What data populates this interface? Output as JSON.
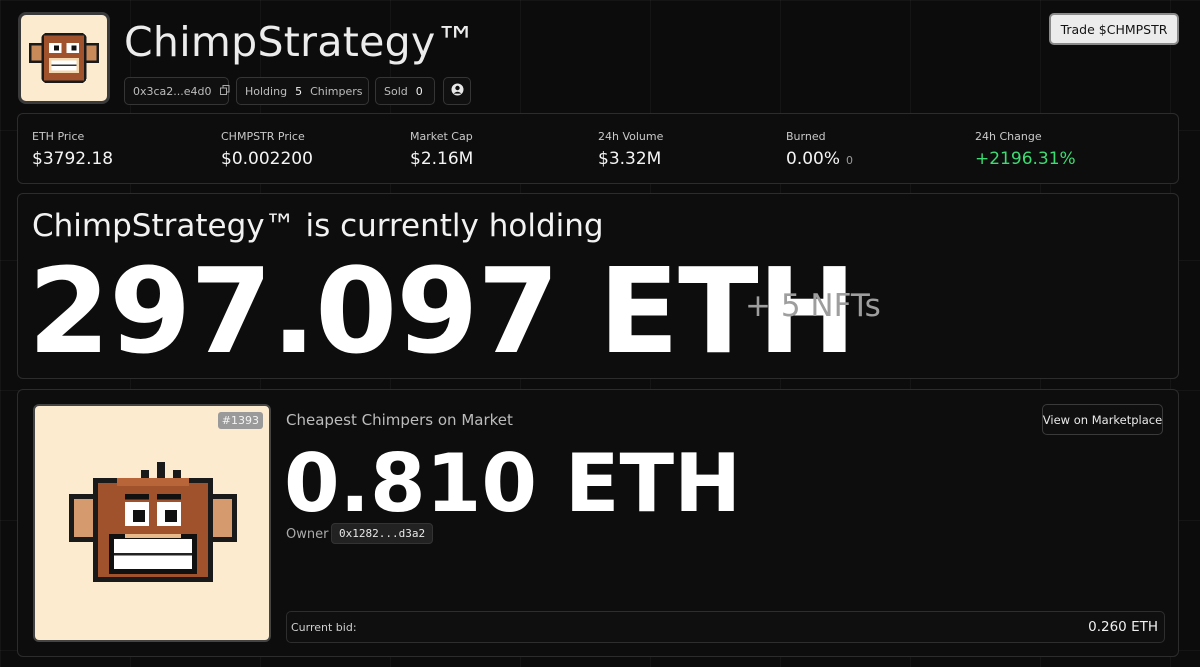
{
  "header": {
    "title": "ChimpStrategy™",
    "contract_address": "0x3ca2...e4d0",
    "holding_label": "Holding",
    "holding_count": "5",
    "holding_unit": "Chimpers",
    "sold_label": "Sold",
    "sold_count": "0",
    "trade_button": "Trade $CHMPSTR"
  },
  "stats": [
    {
      "label": "ETH Price",
      "value": "$3792.18"
    },
    {
      "label": "CHMPSTR Price",
      "value": "$0.002200"
    },
    {
      "label": "Market Cap",
      "value": "$2.16M"
    },
    {
      "label": "24h Volume",
      "value": "$3.32M"
    },
    {
      "label": "Burned",
      "value": "0.00%",
      "sub": "0"
    },
    {
      "label": "24h Change",
      "value": "+2196.31%"
    }
  ],
  "holdings": {
    "heading": "ChimpStrategy™ is currently holding",
    "amount": "297.097 ETH",
    "extra": "+ 5 NFTs"
  },
  "market": {
    "nft_id": "#1393",
    "label": "Cheapest Chimpers on Market",
    "price": "0.810 ETH",
    "owner_label": "Owner",
    "owner_address": "0x1282...d3a2",
    "view_button": "View on Marketplace",
    "current_bid_label": "Current bid:",
    "current_bid_value": "0.260 ETH"
  },
  "colors": {
    "background": "#0c0c0c",
    "positive": "#3ddc73",
    "card_bg": "#fdebd0",
    "monkey_brown": "#a0522d"
  },
  "icons": [
    "copy-icon",
    "avatar-icon",
    "chimp-logo",
    "chimp-nft-image"
  ]
}
